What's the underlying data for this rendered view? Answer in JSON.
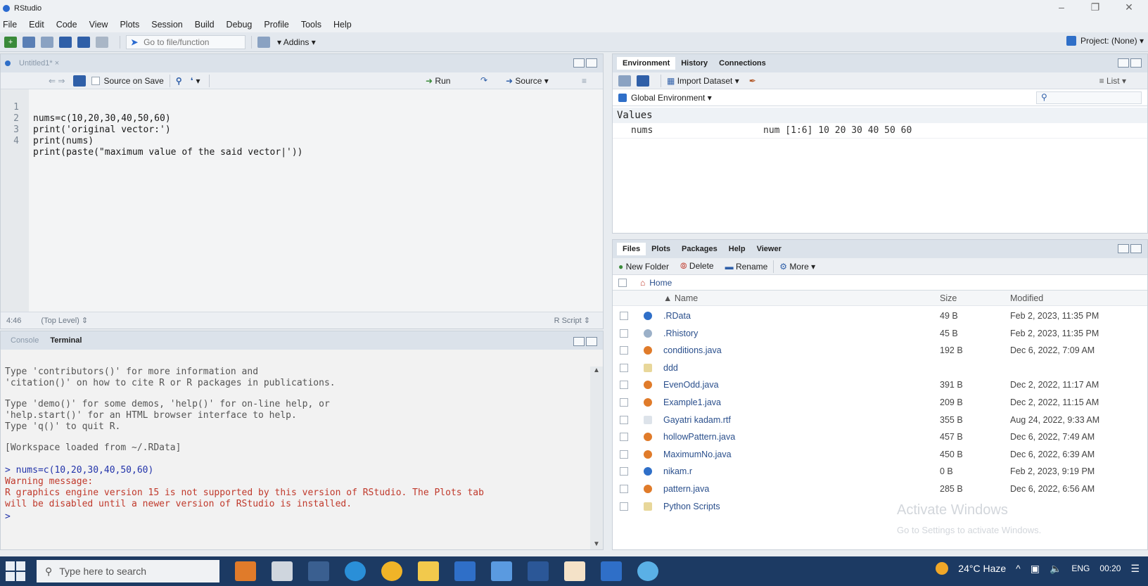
{
  "window": {
    "title": "RStudio"
  },
  "menu": [
    "File",
    "Edit",
    "Code",
    "View",
    "Plots",
    "Session",
    "Build",
    "Debug",
    "Profile",
    "Tools",
    "Help"
  ],
  "toolbar": {
    "goto_placeholder": "Go to file/function",
    "addins": "Addins",
    "project": "Project: (None)"
  },
  "editor": {
    "tab": "Untitled1*",
    "source_on_save": "Source on Save",
    "run": "Run",
    "source": "Source",
    "lines": [
      {
        "n": "1",
        "text": "nums=c(10,20,30,40,50,60)"
      },
      {
        "n": "2",
        "text": "print('original vector:')"
      },
      {
        "n": "3",
        "text": "print(nums)"
      },
      {
        "n": "4",
        "text": "print(paste(\"maximum value of the said vector|'))"
      }
    ],
    "position": "4:46",
    "scope": "(Top Level)",
    "filetype": "R Script"
  },
  "console": {
    "tabs": [
      "Console",
      "Terminal"
    ],
    "lines": [
      {
        "kind": "out",
        "text": "Type 'contributors()' for more information and"
      },
      {
        "kind": "out",
        "text": "'citation()' on how to cite R or R packages in publications."
      },
      {
        "kind": "out",
        "text": "Type 'demo()' for some demos, 'help()' for on-line help, or"
      },
      {
        "kind": "out",
        "text": "'help.start()' for an HTML browser interface to help."
      },
      {
        "kind": "out",
        "text": "Type 'q()' to quit R."
      },
      {
        "kind": "out",
        "text": "[Workspace loaded from ~/.RData]"
      },
      {
        "kind": "cmd",
        "text": "> nums=c(10,20,30,40,50,60)"
      },
      {
        "kind": "err",
        "text": "Warning message:"
      },
      {
        "kind": "err",
        "text": "R graphics engine version 15 is not supported by this version of RStudio. The Plots tab"
      },
      {
        "kind": "err",
        "text": "will be disabled until a newer version of RStudio is installed."
      },
      {
        "kind": "cmd",
        "text": ">"
      }
    ]
  },
  "environment": {
    "tabs": [
      "Environment",
      "History",
      "Connections"
    ],
    "import_dataset": "Import Dataset",
    "list_view": "List",
    "scope": "Global Environment",
    "section": "Values",
    "vars": [
      {
        "name": "nums",
        "value": "num [1:6] 10 20 30 40 50 60"
      }
    ]
  },
  "files": {
    "tabs": [
      "Files",
      "Plots",
      "Packages",
      "Help",
      "Viewer"
    ],
    "actions": {
      "new_folder": "New Folder",
      "delete": "Delete",
      "rename": "Rename",
      "more": "More"
    },
    "path": "Home",
    "columns": {
      "name": "Name",
      "size": "Size",
      "modified": "Modified"
    },
    "rows": [
      {
        "name": ".RData",
        "size": "49 B",
        "modified": "Feb 2, 2023, 11:35 PM",
        "icon": "rdata-icon",
        "color": "#2f6fc8"
      },
      {
        "name": ".Rhistory",
        "size": "45 B",
        "modified": "Feb 2, 2023, 11:35 PM",
        "icon": "rhistory-icon",
        "color": "#9bb0c8"
      },
      {
        "name": "conditions.java",
        "size": "192 B",
        "modified": "Dec 6, 2022, 7:09 AM",
        "icon": "java-file-icon",
        "color": "#e07b2a"
      },
      {
        "name": "ddd",
        "size": "",
        "modified": "",
        "icon": "folder-icon",
        "color": "#e8d79a"
      },
      {
        "name": "EvenOdd.java",
        "size": "391 B",
        "modified": "Dec 2, 2022, 11:17 AM",
        "icon": "java-file-icon",
        "color": "#e07b2a"
      },
      {
        "name": "Example1.java",
        "size": "209 B",
        "modified": "Dec 2, 2022, 11:15 AM",
        "icon": "java-file-icon",
        "color": "#e07b2a"
      },
      {
        "name": "Gayatri kadam.rtf",
        "size": "355 B",
        "modified": "Aug 24, 2022, 9:33 AM",
        "icon": "rtf-file-icon",
        "color": "#dde3ea"
      },
      {
        "name": "hollowPattern.java",
        "size": "457 B",
        "modified": "Dec 6, 2022, 7:49 AM",
        "icon": "java-file-icon",
        "color": "#e07b2a"
      },
      {
        "name": "MaximumNo.java",
        "size": "450 B",
        "modified": "Dec 6, 2022, 6:39 AM",
        "icon": "java-file-icon",
        "color": "#e07b2a"
      },
      {
        "name": "nikam.r",
        "size": "0 B",
        "modified": "Feb 2, 2023, 9:19 PM",
        "icon": "r-file-icon",
        "color": "#2f6fc8"
      },
      {
        "name": "pattern.java",
        "size": "285 B",
        "modified": "Dec 6, 2022, 6:56 AM",
        "icon": "java-file-icon",
        "color": "#e07b2a"
      },
      {
        "name": "Python Scripts",
        "size": "",
        "modified": "",
        "icon": "folder-icon",
        "color": "#e8d79a"
      }
    ]
  },
  "taskbar": {
    "search_placeholder": "Type here to search",
    "weather": "24°C Haze",
    "lang": "ENG",
    "time": "00:20"
  },
  "watermark": {
    "title": "Activate Windows",
    "subtitle": "Go to Settings to activate Windows."
  }
}
